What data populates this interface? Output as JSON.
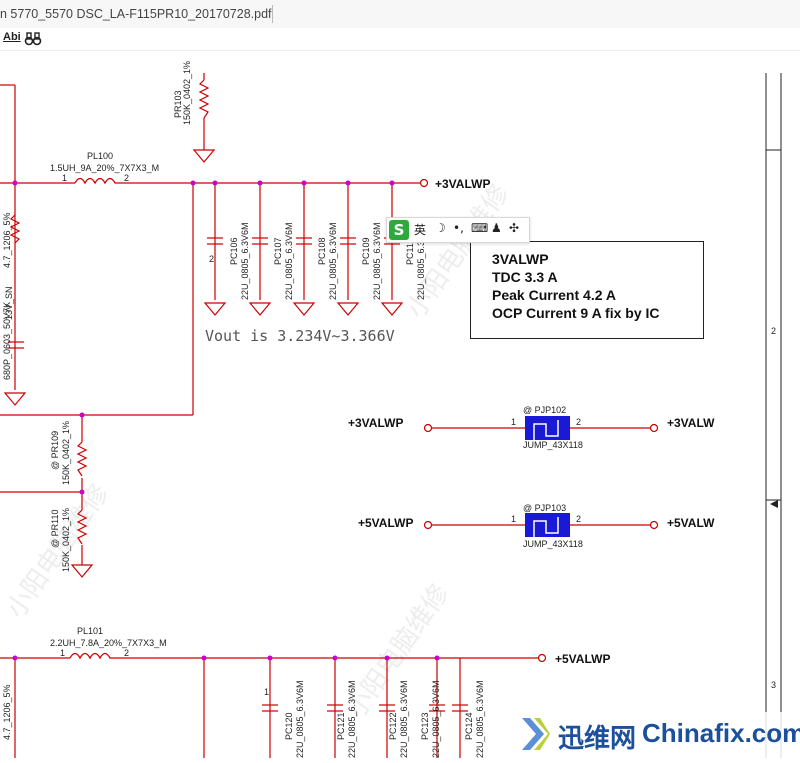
{
  "tab": {
    "title": "n 5770_5570 DSC_LA-F115PR10_20170728.pdf"
  },
  "toolbar": {
    "abi_label": "Abi",
    "binoculars_icon": "binoculars-icon"
  },
  "schematic": {
    "net_3valwp": "+3VALWP",
    "net_3valw": "+3VALW",
    "net_5valwp": "+5VALWP",
    "net_5valw": "+5VALW",
    "pl100_ref": "PL100",
    "pl100_val": "1.5UH_9A_20%_7X7X3_M",
    "pl101_ref": "PL101",
    "pl101_val": "2.2UH_7.8A_20%_7X7X3_M",
    "pr103_ref": "PR103",
    "pr103_val": "150K_0402_1%",
    "pr109_ref": "@ PR109",
    "pr109_val": "150K_0402_1%",
    "pr110_ref": "@ PR110",
    "pr110_val": "150K_0402_1%",
    "pjp102_ref": "@ PJP102",
    "pjp103_ref": "@ PJP103",
    "jump_val": "JUMP_43X118",
    "cap_val": "22U_0805_6.3V6M",
    "pc106": "PC106",
    "pc107": "PC107",
    "pc108": "PC108",
    "pc109": "PC109",
    "pc110": "PC11(",
    "pc120": "PC120",
    "pc121": "PC121",
    "pc122": "PC122",
    "pc123": "PC123",
    "pc124": "PC124",
    "left_res1": "4.7_1206_5%",
    "left_res2": "4.7_1206_5%",
    "left_cap": "680P_0603_50V7K",
    "left_sn": "13V_SN",
    "vout": "Vout is 3.234V~3.366V",
    "pin1": "1",
    "pin2": "2",
    "border_2": "2",
    "border_3": "3"
  },
  "note": {
    "line1": "3VALWP",
    "line2": "TDC 3.3 A",
    "line3": "Peak Current  4.2 A",
    "line4": "OCP Current 9 A fix by IC"
  },
  "ime": {
    "logo": "S",
    "lang": "英",
    "moon": "☽",
    "dot": "•,",
    "keyboard": "⌨",
    "user": "♟",
    "grid": "✣"
  },
  "watermark": {
    "cn": "迅维网",
    "en": "Chinafix.com",
    "diag": "小阳电脑维修"
  },
  "colors": {
    "wire": "#cc0000",
    "junction": "#cc00cc",
    "jumper": "#1a1ad6",
    "ground": "#cc0000"
  }
}
